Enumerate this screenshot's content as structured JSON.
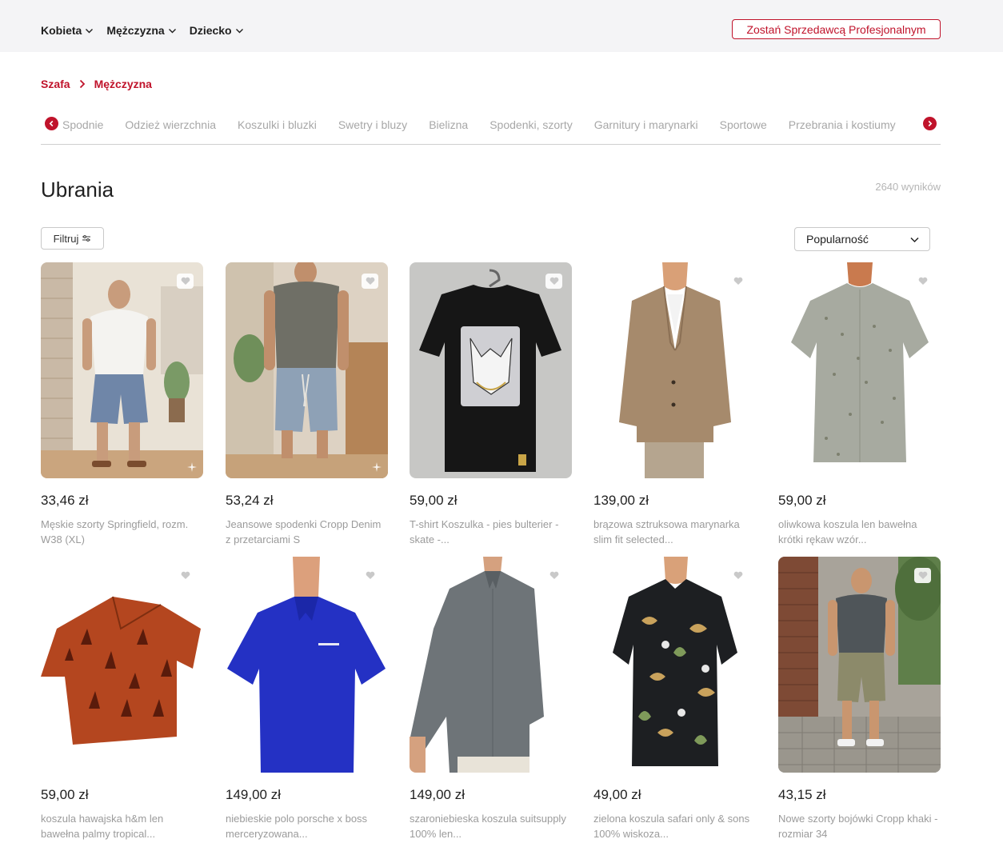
{
  "header": {
    "nav": [
      {
        "label": "Kobieta"
      },
      {
        "label": "Mężczyzna"
      },
      {
        "label": "Dziecko"
      }
    ],
    "seller_button": "Zostań Sprzedawcą Profesjonalnym"
  },
  "breadcrumb": {
    "root": "Szafa",
    "current": "Mężczyzna"
  },
  "categories": [
    "Spodnie",
    "Odzież wierzchnia",
    "Koszulki i bluzki",
    "Swetry i bluzy",
    "Bielizna",
    "Spodenki, szorty",
    "Garnitury i marynarki",
    "Sportowe",
    "Przebrania i kostiumy"
  ],
  "page": {
    "title": "Ubrania",
    "results": "2640 wyników"
  },
  "controls": {
    "filter_label": "Filtruj",
    "sort_value": "Popularność"
  },
  "products": [
    {
      "price": "33,46 zł",
      "title": "Męskie szorty Springfield, rozm. W38 (XL)"
    },
    {
      "price": "53,24 zł",
      "title": "Jeansowe spodenki Cropp Denim z przetarciami S"
    },
    {
      "price": "59,00 zł",
      "title": "T-shirt Koszulka - pies bulterier - skate -..."
    },
    {
      "price": "139,00 zł",
      "title": "brązowa sztruksowa marynarka slim fit selected..."
    },
    {
      "price": "59,00 zł",
      "title": "oliwkowa koszula len bawełna krótki rękaw wzór..."
    },
    {
      "price": "59,00 zł",
      "title": "koszula hawajska h&m len bawełna palmy tropical..."
    },
    {
      "price": "149,00 zł",
      "title": "niebieskie polo porsche x boss merceryzowana..."
    },
    {
      "price": "149,00 zł",
      "title": "szaroniebieska koszula suitsupply 100% len..."
    },
    {
      "price": "49,00 zł",
      "title": "zielona koszula safari only & sons 100% wiskoza..."
    },
    {
      "price": "43,15 zł",
      "title": "Nowe szorty bojówki Cropp khaki - rozmiar 34"
    }
  ],
  "colors": {
    "accent": "#c0132b",
    "topbar": "#f4f4f6",
    "muted_text": "#9b9b9b"
  }
}
